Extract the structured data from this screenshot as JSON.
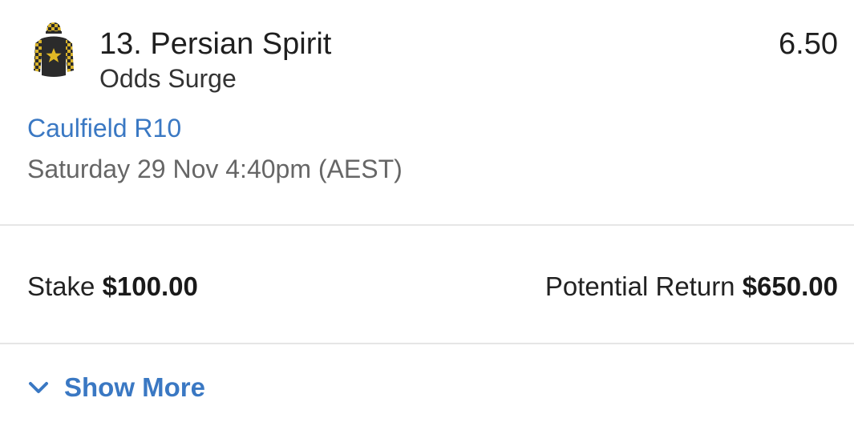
{
  "selection": {
    "runner": "13. Persian Spirit",
    "odds": "6.50",
    "bet_type": "Odds Surge",
    "race": "Caulfield R10",
    "start_time": "Saturday 29 Nov 4:40pm (AEST)",
    "silks_icon": "jockey-silks-icon",
    "silks_colors": {
      "body": "#2b2b2b",
      "check": "#d8b32a",
      "star": "#e0b825"
    }
  },
  "summary": {
    "stake_label": "Stake",
    "stake_value": "$100.00",
    "return_label": "Potential Return",
    "return_value": "$650.00"
  },
  "footer": {
    "show_more_label": "Show More",
    "chevron_icon": "chevron-down-icon"
  },
  "colors": {
    "link": "#3a78c3",
    "divider": "#e6e6e6"
  }
}
